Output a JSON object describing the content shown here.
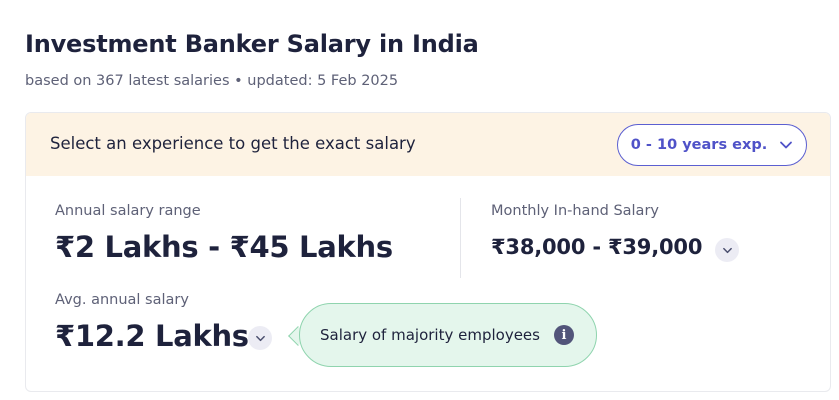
{
  "page": {
    "title": "Investment Banker Salary in India",
    "subtitle": "based on 367 latest salaries • updated: 5 Feb 2025"
  },
  "experience_bar": {
    "prompt": "Select an experience to get the exact salary",
    "selected_value": "0 - 10 years exp."
  },
  "annual_range": {
    "label": "Annual salary range",
    "value": "₹2 Lakhs - ₹45 Lakhs"
  },
  "monthly_inhand": {
    "label": "Monthly In-hand Salary",
    "value": "₹38,000 - ₹39,000"
  },
  "avg_annual": {
    "label": "Avg. annual salary",
    "value": "₹12.2 Lakhs"
  },
  "tooltip": {
    "text": "Salary of majority employees",
    "icon": "info-icon"
  },
  "colors": {
    "header_bg": "#fdf3e4",
    "accent": "#4f52c8",
    "tooltip_bg": "#e4f6ec",
    "tooltip_border": "#8fd4ae"
  }
}
